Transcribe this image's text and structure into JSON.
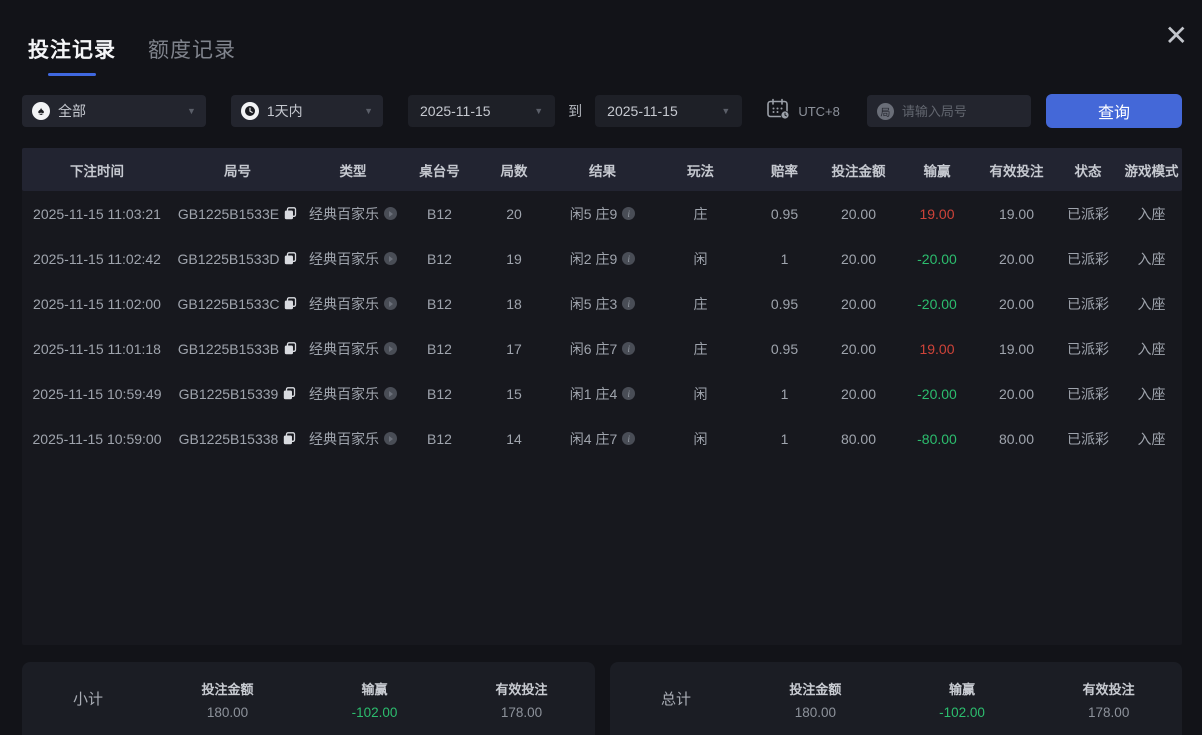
{
  "window": {
    "close_glyph": "✕"
  },
  "tabs": [
    {
      "label": "投注记录",
      "active": true
    },
    {
      "label": "额度记录",
      "active": false
    }
  ],
  "filters": {
    "game_type": {
      "value": "全部",
      "icon": "spade",
      "spade_glyph": "♠"
    },
    "time_range": {
      "value": "1天内",
      "icon": "clock"
    },
    "date_from": "2025-11-15",
    "to_label": "到",
    "date_to": "2025-11-15",
    "timezone_label": "UTC+8",
    "search": {
      "icon_char": "局",
      "placeholder": "请输入局号",
      "value": ""
    },
    "query_button": "查询",
    "caret_glyph": "▼"
  },
  "table": {
    "columns": [
      "下注时间",
      "局号",
      "类型",
      "桌台号",
      "局数",
      "结果",
      "玩法",
      "赔率",
      "投注金额",
      "输赢",
      "有效投注",
      "状态",
      "游戏模式"
    ],
    "rows": [
      {
        "time": "2025-11-15 11:03:21",
        "round_id": "GB1225B1533E",
        "type": "经典百家乐",
        "table_no": "B12",
        "round": "20",
        "result": "闲5 庄9",
        "play": "庄",
        "odds": "0.95",
        "bet": "20.00",
        "win": "19.00",
        "win_color": "red",
        "valid": "19.00",
        "status": "已派彩",
        "mode": "入座"
      },
      {
        "time": "2025-11-15 11:02:42",
        "round_id": "GB1225B1533D",
        "type": "经典百家乐",
        "table_no": "B12",
        "round": "19",
        "result": "闲2 庄9",
        "play": "闲",
        "odds": "1",
        "bet": "20.00",
        "win": "-20.00",
        "win_color": "green",
        "valid": "20.00",
        "status": "已派彩",
        "mode": "入座"
      },
      {
        "time": "2025-11-15 11:02:00",
        "round_id": "GB1225B1533C",
        "type": "经典百家乐",
        "table_no": "B12",
        "round": "18",
        "result": "闲5 庄3",
        "play": "庄",
        "odds": "0.95",
        "bet": "20.00",
        "win": "-20.00",
        "win_color": "green",
        "valid": "20.00",
        "status": "已派彩",
        "mode": "入座"
      },
      {
        "time": "2025-11-15 11:01:18",
        "round_id": "GB1225B1533B",
        "type": "经典百家乐",
        "table_no": "B12",
        "round": "17",
        "result": "闲6 庄7",
        "play": "庄",
        "odds": "0.95",
        "bet": "20.00",
        "win": "19.00",
        "win_color": "red",
        "valid": "19.00",
        "status": "已派彩",
        "mode": "入座"
      },
      {
        "time": "2025-11-15 10:59:49",
        "round_id": "GB1225B15339",
        "type": "经典百家乐",
        "table_no": "B12",
        "round": "15",
        "result": "闲1 庄4",
        "play": "闲",
        "odds": "1",
        "bet": "20.00",
        "win": "-20.00",
        "win_color": "green",
        "valid": "20.00",
        "status": "已派彩",
        "mode": "入座"
      },
      {
        "time": "2025-11-15 10:59:00",
        "round_id": "GB1225B15338",
        "type": "经典百家乐",
        "table_no": "B12",
        "round": "14",
        "result": "闲4 庄7",
        "play": "闲",
        "odds": "1",
        "bet": "80.00",
        "win": "-80.00",
        "win_color": "green",
        "valid": "80.00",
        "status": "已派彩",
        "mode": "入座"
      }
    ]
  },
  "summary": {
    "subtotal": {
      "title": "小计",
      "items": [
        {
          "label": "投注金额",
          "value": "180.00",
          "color": ""
        },
        {
          "label": "输赢",
          "value": "-102.00",
          "color": "green"
        },
        {
          "label": "有效投注",
          "value": "178.00",
          "color": ""
        }
      ]
    },
    "total": {
      "title": "总计",
      "items": [
        {
          "label": "投注金额",
          "value": "180.00",
          "color": ""
        },
        {
          "label": "输赢",
          "value": "-102.00",
          "color": "green"
        },
        {
          "label": "有效投注",
          "value": "178.00",
          "color": ""
        }
      ]
    }
  },
  "colors": {
    "accent_blue": "#4468d8",
    "tab_underline": "#3f68e0",
    "loss_green": "#2cbd6e",
    "win_red": "#ce4339"
  }
}
